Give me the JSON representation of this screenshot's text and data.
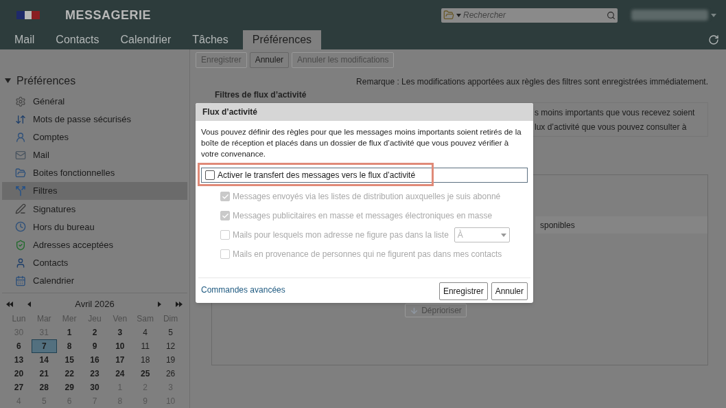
{
  "app": {
    "title": "MESSAGERIE",
    "search": {
      "placeholder": "Rechercher"
    }
  },
  "tabs": [
    {
      "label": "Mail",
      "selected": false
    },
    {
      "label": "Contacts",
      "selected": false
    },
    {
      "label": "Calendrier",
      "selected": false
    },
    {
      "label": "Tâches",
      "selected": false
    },
    {
      "label": "Préférences",
      "selected": true
    }
  ],
  "toolbar": [
    {
      "label": "Enregistrer",
      "disabled": true
    },
    {
      "label": "Annuler",
      "disabled": false
    },
    {
      "label": "Annuler les modifications",
      "disabled": true
    }
  ],
  "sidebar": {
    "title": "Préférences",
    "expanded": true,
    "items": [
      {
        "label": "Général",
        "selected": false
      },
      {
        "label": "Mots de passe sécurisés",
        "selected": false
      },
      {
        "label": "Comptes",
        "selected": false
      },
      {
        "label": "Mail",
        "selected": false
      },
      {
        "label": "Boites fonctionnelles",
        "selected": false
      },
      {
        "label": "Filtres",
        "selected": true
      },
      {
        "label": "Signatures",
        "selected": false
      },
      {
        "label": "Hors du bureau",
        "selected": false
      },
      {
        "label": "Adresses acceptées",
        "selected": false
      },
      {
        "label": "Contacts",
        "selected": false
      },
      {
        "label": "Calendrier",
        "selected": false
      }
    ]
  },
  "calendar": {
    "month": "Avril 2026",
    "weekdays": [
      "Lun",
      "Mar",
      "Mer",
      "Jeu",
      "Ven",
      "Sam",
      "Dim"
    ],
    "weeks": [
      [
        {
          "day": "30",
          "kind": "muted",
          "selected": false
        },
        {
          "day": "31",
          "kind": "muted",
          "selected": false
        },
        {
          "day": "1",
          "kind": "bold",
          "selected": false
        },
        {
          "day": "2",
          "kind": "bold",
          "selected": false
        },
        {
          "day": "3",
          "kind": "bold",
          "selected": false
        },
        {
          "day": "4",
          "kind": "plain",
          "selected": false
        },
        {
          "day": "5",
          "kind": "plain",
          "selected": false
        }
      ],
      [
        {
          "day": "6",
          "kind": "bold",
          "selected": false
        },
        {
          "day": "7",
          "kind": "bold",
          "selected": true
        },
        {
          "day": "8",
          "kind": "bold",
          "selected": false
        },
        {
          "day": "9",
          "kind": "bold",
          "selected": false
        },
        {
          "day": "10",
          "kind": "bold",
          "selected": false
        },
        {
          "day": "11",
          "kind": "plain",
          "selected": false
        },
        {
          "day": "12",
          "kind": "plain",
          "selected": false
        }
      ],
      [
        {
          "day": "13",
          "kind": "bold",
          "selected": false
        },
        {
          "day": "14",
          "kind": "bold",
          "selected": false
        },
        {
          "day": "15",
          "kind": "bold",
          "selected": false
        },
        {
          "day": "16",
          "kind": "bold",
          "selected": false
        },
        {
          "day": "17",
          "kind": "bold",
          "selected": false
        },
        {
          "day": "18",
          "kind": "plain",
          "selected": false
        },
        {
          "day": "19",
          "kind": "plain",
          "selected": false
        }
      ],
      [
        {
          "day": "20",
          "kind": "bold",
          "selected": false
        },
        {
          "day": "21",
          "kind": "bold",
          "selected": false
        },
        {
          "day": "22",
          "kind": "bold",
          "selected": false
        },
        {
          "day": "23",
          "kind": "bold",
          "selected": false
        },
        {
          "day": "24",
          "kind": "bold",
          "selected": false
        },
        {
          "day": "25",
          "kind": "bold",
          "selected": false
        },
        {
          "day": "26",
          "kind": "plain",
          "selected": false
        }
      ],
      [
        {
          "day": "27",
          "kind": "bold",
          "selected": false
        },
        {
          "day": "28",
          "kind": "bold",
          "selected": false
        },
        {
          "day": "29",
          "kind": "bold",
          "selected": false
        },
        {
          "day": "30",
          "kind": "bold",
          "selected": false
        },
        {
          "day": "1",
          "kind": "muted",
          "selected": false
        },
        {
          "day": "2",
          "kind": "muted",
          "selected": false
        },
        {
          "day": "3",
          "kind": "muted",
          "selected": false
        }
      ],
      [
        {
          "day": "4",
          "kind": "muted",
          "selected": false
        },
        {
          "day": "5",
          "kind": "muted",
          "selected": false
        },
        {
          "day": "6",
          "kind": "muted",
          "selected": false
        },
        {
          "day": "7",
          "kind": "muted",
          "selected": false
        },
        {
          "day": "8",
          "kind": "muted",
          "selected": false
        },
        {
          "day": "9",
          "kind": "muted",
          "selected": false
        },
        {
          "day": "10",
          "kind": "muted",
          "selected": false
        }
      ]
    ]
  },
  "main": {
    "note": "Remarque : Les modifications apportées aux règles des filtres sont enregistrées immédiatement.",
    "section_title": "Filtres de flux d’activité",
    "intro_fragments": [
      "s moins importants que vous recevez soient",
      "lux d’activité que vous pouvez consulter à"
    ],
    "list_header_fragment": "sponibles",
    "deprioritize_button": {
      "label": "Déprioriser",
      "disabled": true
    }
  },
  "dialog": {
    "title": "Flux d’activité",
    "description": "Vous pouvez définir des règles pour que les messages moins importants soient retirés de la boîte de réception et placés dans un dossier de flux d’activité que vous pouvez vérifier à votre convenance.",
    "enable": {
      "label": "Activer le transfert des messages vers le flux d’activité",
      "checked": false,
      "highlighted": true
    },
    "options": [
      {
        "kind": "checkbox",
        "label": "Messages envoyés via les listes de distribution auxquelles je suis abonné",
        "checked": true,
        "disabled": true
      },
      {
        "kind": "checkbox",
        "label": "Messages publicitaires en masse et messages électroniques en masse",
        "checked": true,
        "disabled": true
      },
      {
        "kind": "checkbox-select",
        "label": "Mails pour lesquels mon adresse ne figure pas dans la liste",
        "checked": false,
        "disabled": true,
        "select_value": "À"
      },
      {
        "kind": "checkbox",
        "label": "Mails en provenance de personnes qui ne figurent pas dans mes contacts",
        "checked": false,
        "disabled": true
      }
    ],
    "link": "Commandes avancées",
    "buttons": [
      "Enregistrer",
      "Annuler"
    ]
  }
}
